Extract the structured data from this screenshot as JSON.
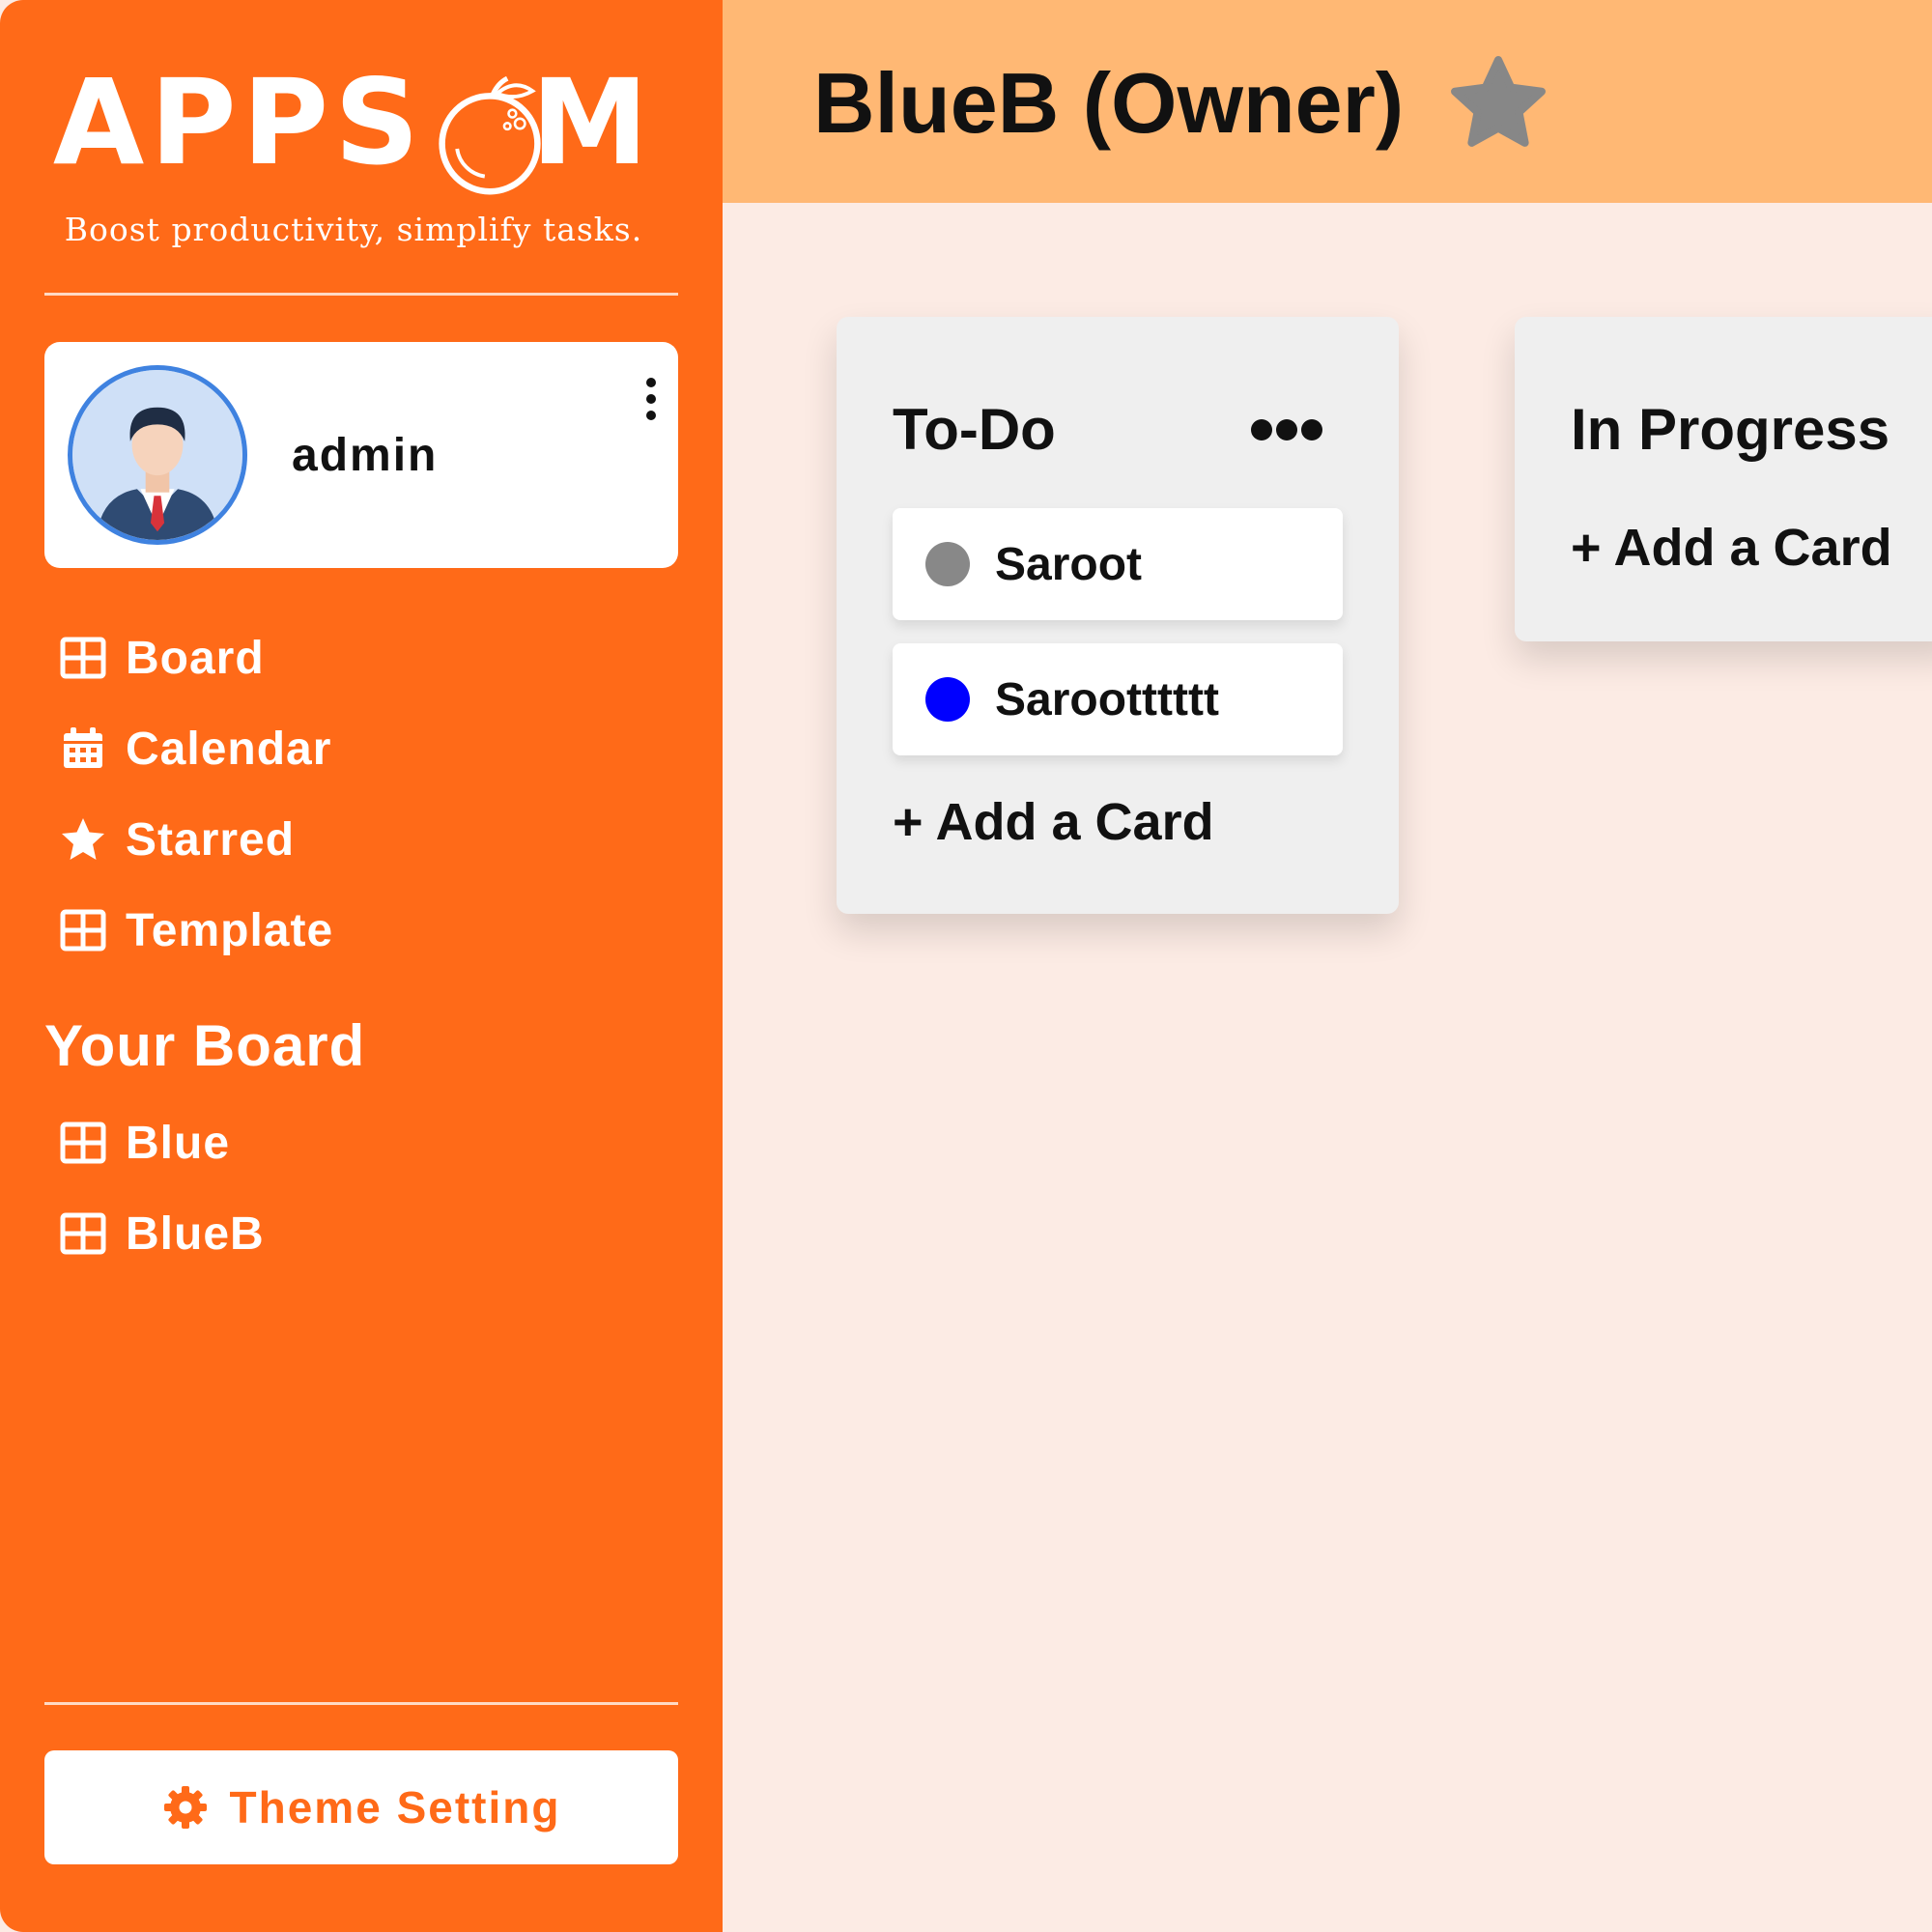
{
  "logo": {
    "title": "APPSOM",
    "tagline": "Boost productivity, simplify tasks."
  },
  "profile": {
    "name": "admin",
    "menu_icon": "vertical-dots-icon"
  },
  "nav": [
    {
      "label": "Board",
      "icon": "grid-icon"
    },
    {
      "label": "Calendar",
      "icon": "calendar-icon"
    },
    {
      "label": "Starred",
      "icon": "star-icon"
    },
    {
      "label": "Template",
      "icon": "grid-icon"
    }
  ],
  "your_boards": {
    "title": "Your Board",
    "items": [
      {
        "label": "Blue",
        "icon": "grid-icon"
      },
      {
        "label": "BlueB",
        "icon": "grid-icon"
      }
    ]
  },
  "theme_button": {
    "label": "Theme Setting",
    "icon": "gear-icon"
  },
  "header": {
    "board_title": "BlueB (Owner)",
    "star_icon": "star-icon"
  },
  "lists": [
    {
      "title": "To-Do",
      "cards": [
        {
          "text": "Saroot",
          "color": "#888888"
        },
        {
          "text": "Sarootttttt",
          "color": "#0000ff"
        }
      ],
      "add_label": "+ Add a Card"
    },
    {
      "title": "In Progress",
      "cards": [],
      "add_label": "+ Add a Card"
    }
  ],
  "colors": {
    "sidebar": "#ff6a18",
    "header": "#ffb874",
    "board_bg": "#fcebe4",
    "list_bg": "#efefef"
  }
}
